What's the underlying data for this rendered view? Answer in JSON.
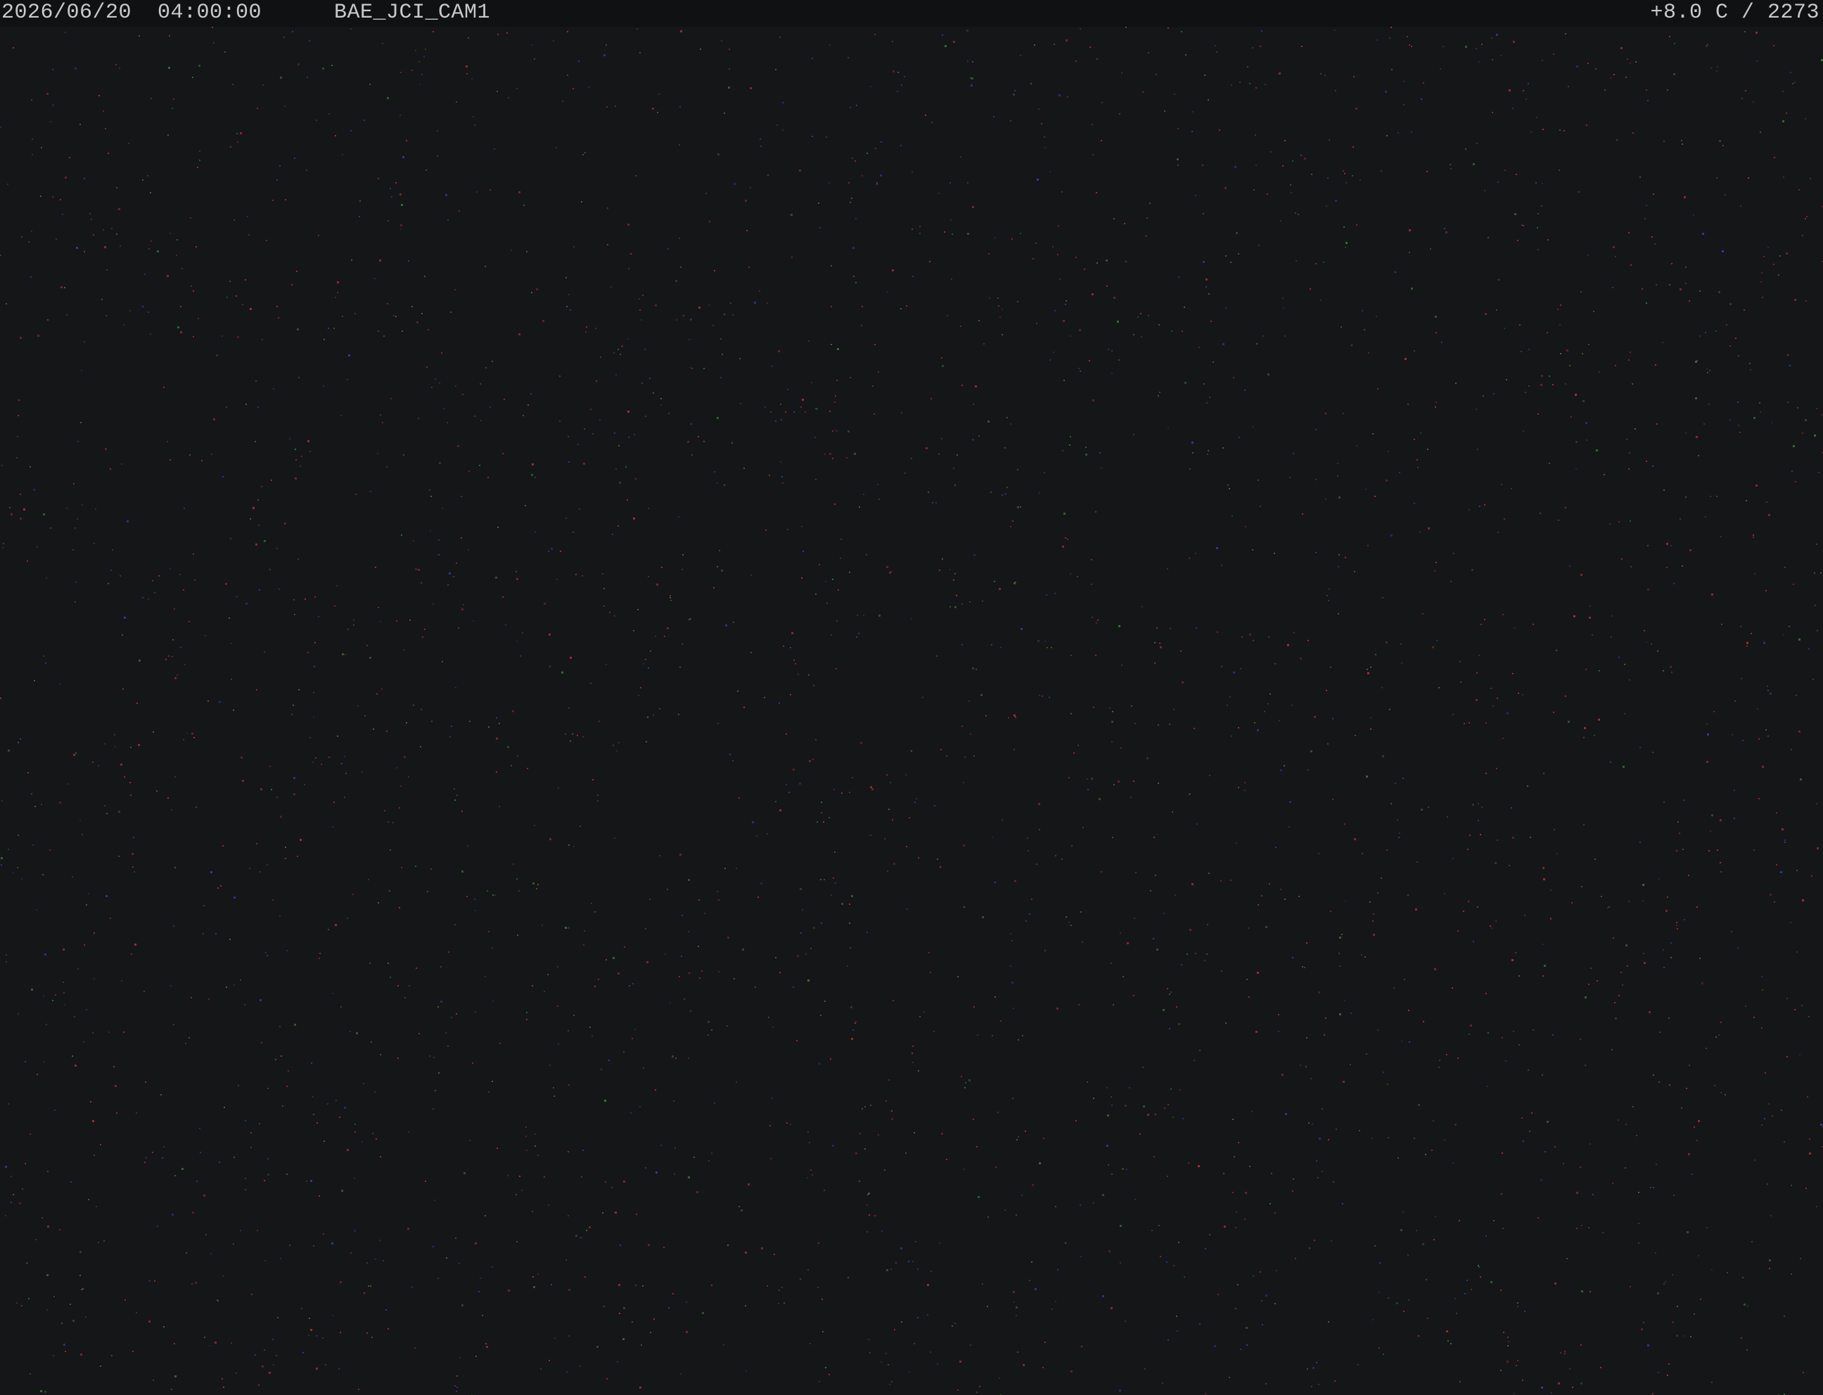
{
  "overlay": {
    "timestamp": "2026/06/20  04:00:00",
    "camera_name": "BAE_JCI_CAM1",
    "sensor_readout": "+8.0 C / 2273"
  },
  "colors": {
    "sky_background": "#151617",
    "overlay_bar": "#101112",
    "overlay_text": "#c9c9c9",
    "noise_red": "#b0303a",
    "noise_green": "#3a7a3a",
    "noise_blue": "#3a3ab0"
  }
}
